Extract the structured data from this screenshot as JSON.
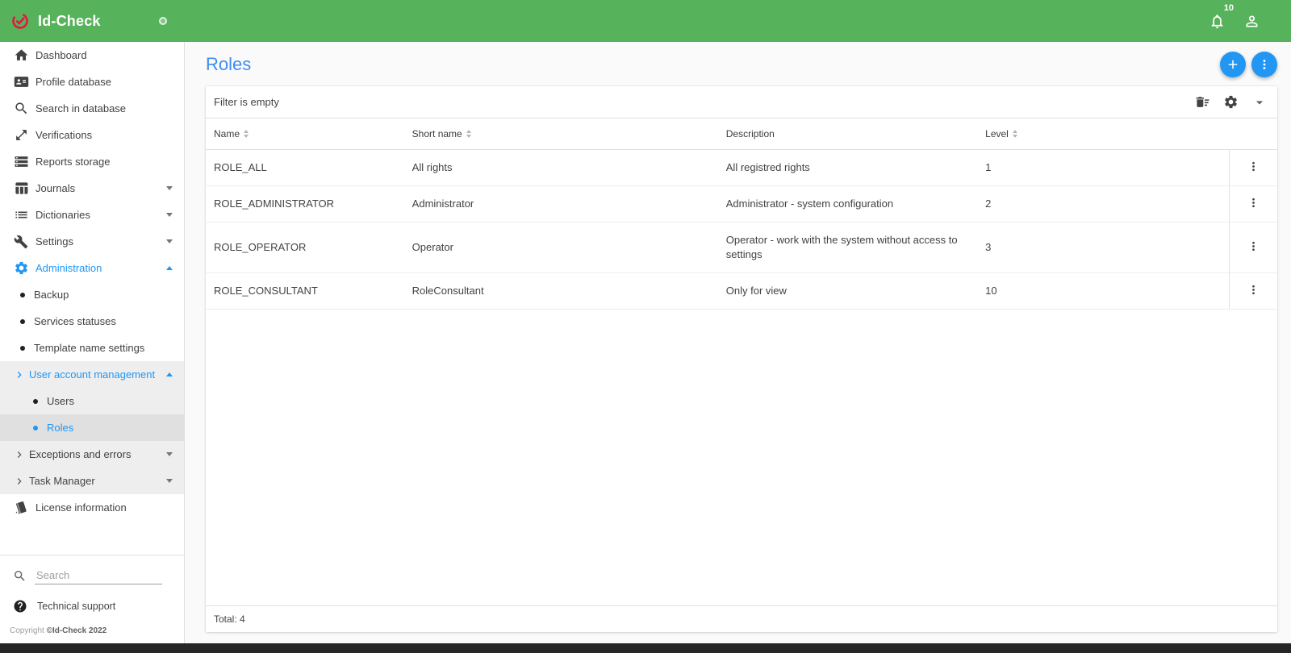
{
  "header": {
    "app_title": "Id-Check",
    "notification_count": "10",
    "icons": {
      "logo": "check-ring-logo",
      "toggle": "circle-toggle",
      "bell": "notifications-bell",
      "user": "person"
    }
  },
  "colors": {
    "header_green": "#56b35b",
    "accent_blue": "#2196f3",
    "title_blue": "#3d8df5",
    "logo_red": "#e5173f",
    "selected_gray": "#e0e0e0",
    "group_gray": "#eeeeee"
  },
  "sidebar": {
    "items": [
      {
        "label": "Dashboard",
        "icon": "home-icon"
      },
      {
        "label": "Profile database",
        "icon": "contact-card-icon"
      },
      {
        "label": "Search in database",
        "icon": "search-icon"
      },
      {
        "label": "Verifications",
        "icon": "expand-arrows-icon"
      },
      {
        "label": "Reports storage",
        "icon": "storage-icon"
      },
      {
        "label": "Journals",
        "icon": "table-icon",
        "expandable": true
      },
      {
        "label": "Dictionaries",
        "icon": "list-icon",
        "expandable": true
      },
      {
        "label": "Settings",
        "icon": "wrench-icon",
        "expandable": true
      },
      {
        "label": "Administration",
        "icon": "gear-icon",
        "expandable": true,
        "expanded": true,
        "active": true
      }
    ],
    "administration_children": [
      {
        "label": "Backup"
      },
      {
        "label": "Services statuses"
      },
      {
        "label": "Template name settings"
      },
      {
        "label": "User account management",
        "expanded": true,
        "active": true
      },
      {
        "label": "Users"
      },
      {
        "label": "Roles",
        "selected": true
      },
      {
        "label": "Exceptions and errors",
        "expandable": true
      },
      {
        "label": "Task Manager",
        "expandable": true
      }
    ],
    "license_item": {
      "label": "License information",
      "icon": "book-icon"
    },
    "search_placeholder": "Search",
    "technical_support": "Technical support",
    "copyright_prefix": "Copyright ",
    "copyright_strong": "©Id-Check 2022"
  },
  "page": {
    "title": "Roles",
    "filter_status": "Filter is empty",
    "total": "Total: 4"
  },
  "table": {
    "columns": [
      {
        "label": "Name",
        "sortable": true
      },
      {
        "label": "Short name",
        "sortable": true
      },
      {
        "label": "Description",
        "sortable": false
      },
      {
        "label": "Level",
        "sortable": true
      }
    ],
    "rows": [
      {
        "name": "ROLE_ALL",
        "short_name": "All rights",
        "description": "All registred rights",
        "level": "1"
      },
      {
        "name": "ROLE_ADMINISTRATOR",
        "short_name": "Administrator",
        "description": "Administrator - system configuration",
        "level": "2"
      },
      {
        "name": "ROLE_OPERATOR",
        "short_name": "Operator",
        "description": "Operator - work with the system without access to settings",
        "level": "3"
      },
      {
        "name": "ROLE_CONSULTANT",
        "short_name": "RoleConsultant",
        "description": "Only for view",
        "level": "10"
      }
    ]
  }
}
